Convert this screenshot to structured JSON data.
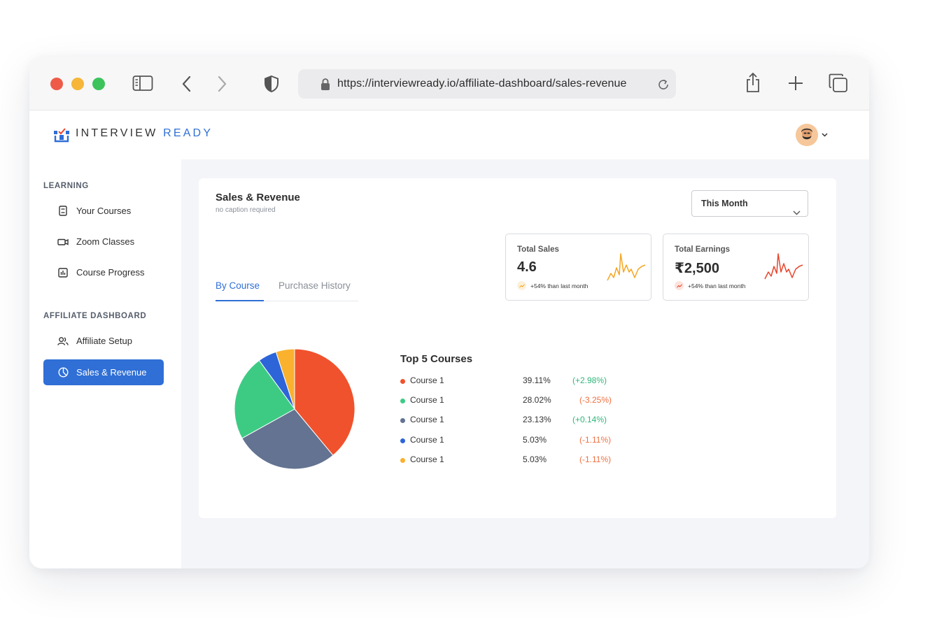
{
  "browser": {
    "url": "https://interviewready.io/affiliate-dashboard/sales-revenue",
    "icons": [
      "sidebar-toggle-icon",
      "back-icon",
      "forward-icon",
      "shield-icon",
      "lock-icon",
      "reload-icon",
      "share-icon",
      "new-tab-icon",
      "tabs-icon"
    ],
    "traffic_lights": [
      "#ee5b48",
      "#f5b63a",
      "#3dc35c"
    ]
  },
  "brand": {
    "name_part1": "INTERVIEW",
    "name_part2": "READY",
    "accent": "#2f6fd6"
  },
  "sidebar": {
    "learning_label": "LEARNING",
    "learning_items": [
      {
        "label": "Your Courses",
        "icon": "book-icon"
      },
      {
        "label": "Zoom Classes",
        "icon": "video-icon"
      },
      {
        "label": "Course Progress",
        "icon": "bar-chart-icon"
      }
    ],
    "affiliate_label": "AFFILIATE DASHBOARD",
    "affiliate_items": [
      {
        "label": "Affiliate Setup",
        "icon": "users-icon"
      },
      {
        "label": "Sales & Revenue",
        "icon": "pie-chart-icon",
        "active": true
      }
    ]
  },
  "main": {
    "title": "Sales & Revenue",
    "caption": "no caption required",
    "period_select": "This Month",
    "tabs": [
      "By Course",
      "Purchase History"
    ],
    "stats": [
      {
        "label": "Total Sales",
        "value": "4.6",
        "trend": "+54% than last month",
        "color": "#f5a623"
      },
      {
        "label": "Total Earnings",
        "value": "₹2,500",
        "trend": "+54% than last month",
        "color": "#e8452c"
      }
    ],
    "top_courses_title": "Top 5 Courses",
    "top_courses": [
      {
        "name": "Course 1",
        "percent": "39.11%",
        "change": "(+2.98%)",
        "color": "#f0522d",
        "positive": true
      },
      {
        "name": "Course 1",
        "percent": "28.02%",
        "change": "(-3.25%)",
        "color": "#3dcb84",
        "positive": false
      },
      {
        "name": "Course 1",
        "percent": "23.13%",
        "change": "(+0.14%)",
        "color": "#637391",
        "positive": true
      },
      {
        "name": "Course 1",
        "percent": "5.03%",
        "change": "(-1.11%)",
        "color": "#2d65d8",
        "positive": false
      },
      {
        "name": "Course 1",
        "percent": "5.03%",
        "change": "(-1.11%)",
        "color": "#f9b12e",
        "positive": false
      }
    ]
  },
  "chart_data": {
    "type": "pie",
    "categories": [
      "Course 1",
      "Course 1",
      "Course 1",
      "Course 1",
      "Course 1"
    ],
    "values": [
      39.11,
      28.02,
      23.13,
      5.03,
      5.03
    ],
    "colors": [
      "#f0522d",
      "#637391",
      "#3dcb84",
      "#2d65d8",
      "#f9b12e"
    ],
    "title": "Top 5 Courses"
  }
}
